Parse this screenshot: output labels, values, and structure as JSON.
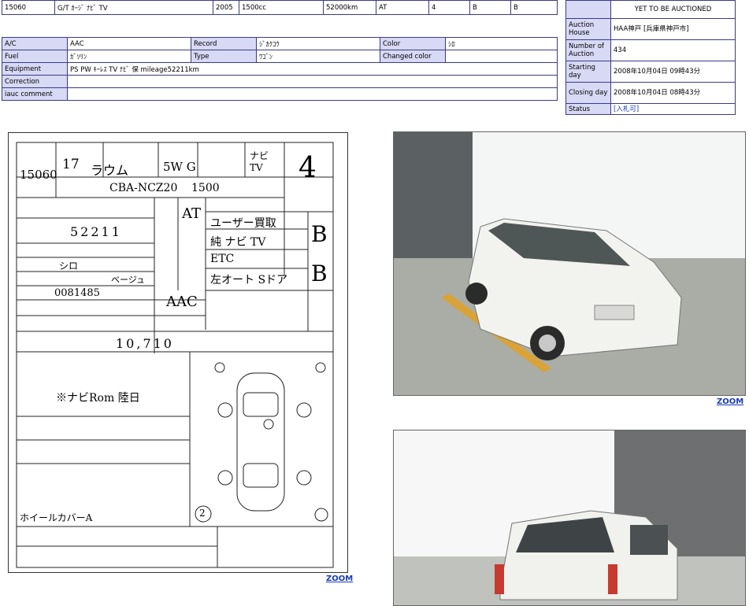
{
  "top_row": {
    "lot": "15060",
    "model": "G/T ｶｰｼﾞ ﾅﾋﾞ TV",
    "year": "2005",
    "cc": "1500cc",
    "mileage": "52000km",
    "trans": "AT",
    "doors": "4",
    "score": "B",
    "interior": "B"
  },
  "detail": {
    "rows": [
      {
        "l1": "A/C",
        "v1": "AAC",
        "l2": "Record",
        "v2": "ｼﾞｶｸｺｳ",
        "l3": "Color",
        "v3": "ｼﾛ"
      },
      {
        "l1": "Fuel",
        "v1": "ｶﾞｿﾘﾝ",
        "l2": "Type",
        "v2": "ﾜｺﾞﾝ",
        "l3": "Changed color",
        "v3": ""
      }
    ],
    "equipment_label": "Equipment",
    "equipment": "PS PW ｷｰﾚｽ TV ﾅﾋﾞ 保 mileage52211km",
    "correction_label": "Correction",
    "correction": "",
    "comment_label": "iauc comment",
    "comment": ""
  },
  "right": {
    "header_tail": "YET TO BE AUCTIONED",
    "house_label": "Auction House",
    "house": "HAA神戸 [兵庫県神戸市]",
    "num_label": "Number of Auction",
    "num": "434",
    "start_label": "Starting day",
    "start": "2008年10月04日 09時43分",
    "close_label": "Closing day",
    "close": "2008年10月04日 08時43分",
    "status_label": "Status",
    "status": "[入札可]"
  },
  "sheet": {
    "lot": "15060",
    "year": "17",
    "name": "ラウム",
    "grade": "5W G",
    "navi": "ナビ TV",
    "score": "4",
    "type": "CBA-NCZ20",
    "cc": "1500",
    "mileage": "52211",
    "trans": "AT",
    "aircon": "AAC",
    "points": [
      "ユーザー買取",
      "純 ナビ TV",
      "ETC",
      "左オート Sドア"
    ],
    "color": "シロ",
    "interior_color": "ベージュ",
    "chassis": "0081485",
    "recycle": "10,710",
    "score_int": "B",
    "score_ext": "B",
    "note": "※ナビRom 陸日",
    "extra": "ホイールカバーA",
    "tag": "2"
  },
  "zoom_label": "ZOOM",
  "colors": {
    "label_bg": "#d7d9f5",
    "border": "#3a3a8a",
    "link": "#1a3bb5"
  }
}
